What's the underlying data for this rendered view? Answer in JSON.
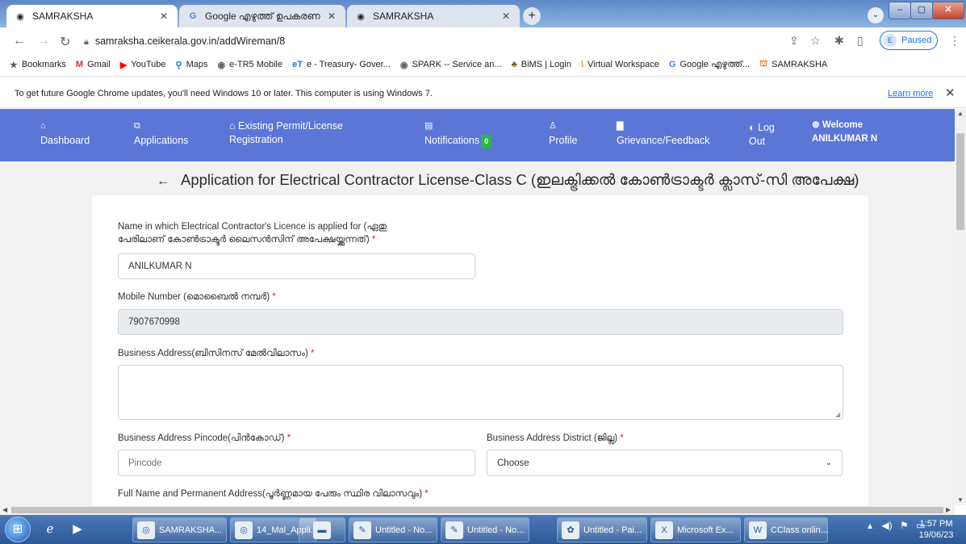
{
  "browser": {
    "tabs": [
      {
        "title": "SAMRAKSHA",
        "icon": "globe-icon",
        "active": true
      },
      {
        "title": "Google എഴുത്ത് ഉപകരണ",
        "icon": "google-icon",
        "active": false
      },
      {
        "title": "SAMRAKSHA",
        "icon": "globe-icon",
        "active": false
      }
    ],
    "url": "samraksha.ceikerala.gov.in/addWireman/8",
    "profile_status": "Paused",
    "profile_initial": "E",
    "bookmarks": [
      {
        "label": "Bookmarks",
        "icon": "star-icon",
        "color": "#5f6368"
      },
      {
        "label": "Gmail",
        "icon": "gmail-icon",
        "color": "#d93025"
      },
      {
        "label": "YouTube",
        "icon": "youtube-icon",
        "color": "#ff0000"
      },
      {
        "label": "Maps",
        "icon": "maps-icon",
        "color": "#1a73e8"
      },
      {
        "label": "e-TR5 Mobile",
        "icon": "globe-icon",
        "color": "#5f6368"
      },
      {
        "label": "e - Treasury- Gover...",
        "icon": "treasury-icon",
        "color": "#1a73e8"
      },
      {
        "label": "SPARK -- Service an...",
        "icon": "globe-icon",
        "color": "#5f6368"
      },
      {
        "label": "BiMS | Login",
        "icon": "bims-icon",
        "color": "#7a5a10"
      },
      {
        "label": "Virtual Workspace",
        "icon": "workspace-icon",
        "color": "#f29900"
      },
      {
        "label": "Google എഴുത്ത്...",
        "icon": "google-icon",
        "color": "#4285f4"
      },
      {
        "label": "SAMRAKSHA",
        "icon": "samraksha-icon",
        "color": "#e8710a"
      }
    ]
  },
  "infobar": {
    "message": "To get future Google Chrome updates, you'll need Windows 10 or later. This computer is using Windows 7.",
    "learn_more": "Learn more"
  },
  "sitenav": {
    "dashboard": "Dashboard",
    "applications": "Applications",
    "existing_line1": "Existing Permit/License",
    "existing_line2": "Registration",
    "notifications": "Notifications",
    "notifications_count": "0",
    "profile": "Profile",
    "grievance": "Grievance/Feedback",
    "logout_line1": "Log",
    "logout_line2": "Out",
    "welcome": "Welcome",
    "user": "ANILKUMAR N"
  },
  "form": {
    "title": "Application for Electrical Contractor License-Class C (ഇലക്ട്രിക്കൽ കോൺട്രാക്ടർ ക്ലാസ്-സി അപേക്ഷ)",
    "name_label_line1": "Name in which Electrical Contractor's Licence is applied for (ഏതു",
    "name_label_line2": "പേരിലാണ് കോൺട്രാക്ടർ ലൈസൻസിന് അപേക്ഷയ്ക്കുന്നത്)",
    "name_value": "ANILKUMAR N",
    "mobile_label": "Mobile Number (മൊബൈൽ നമ്പർ)",
    "mobile_value": "7907670998",
    "address_label": "Business Address(ബിസിനസ് മേൽവിലാസം)",
    "address_value": "",
    "pincode_label": "Business Address Pincode(പിൻകോഡ്)",
    "pincode_placeholder": "Pincode",
    "district_label": "Business Address District (ജില്ല)",
    "district_value": "Choose",
    "fullname_label": "Full Name and Permanent Address(പൂർണ്ണമായ പേരും സ്ഥിര വിലാസവും)",
    "required_mark": "*"
  },
  "taskbar": {
    "items": [
      {
        "label": "SAMRAKSHA...",
        "icon": "chrome-icon"
      },
      {
        "label": "14_Mal_Appli...",
        "icon": "chrome-icon"
      },
      {
        "label": "",
        "icon": "folder-icon"
      },
      {
        "label": "Untitled - No...",
        "icon": "notepad-icon"
      },
      {
        "label": "Untitled - No...",
        "icon": "notepad-icon"
      },
      {
        "label": "Untitled - Pai...",
        "icon": "paint-icon"
      },
      {
        "label": "Microsoft Ex...",
        "icon": "excel-icon"
      },
      {
        "label": "CClass onlin...",
        "icon": "word-icon"
      }
    ],
    "time": "1:57 PM",
    "date": "19/06/23"
  }
}
